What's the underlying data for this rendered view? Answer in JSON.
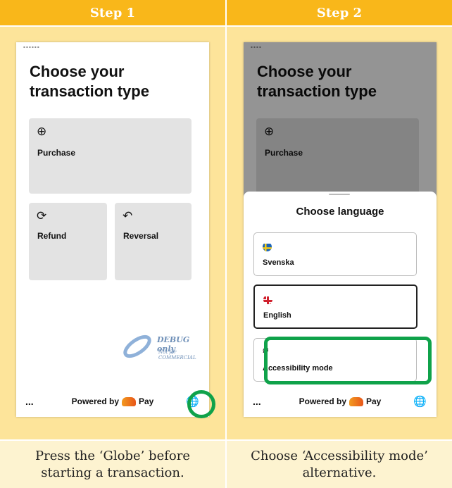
{
  "steps": [
    {
      "header": "Step 1",
      "caption_line1": "Press the ‘Globe’ before",
      "caption_line2": "starting a transaction.",
      "screen": {
        "title_line1": "Choose your",
        "title_line2": "transaction type",
        "tiles": [
          {
            "label": "Purchase",
            "icon": "plus-circle-icon"
          },
          {
            "label": "Refund",
            "icon": "refresh-icon"
          },
          {
            "label": "Reversal",
            "icon": "reverse-icon"
          }
        ],
        "footer": {
          "more": "...",
          "powered_prefix": "Powered by",
          "powered_suffix": "Pay",
          "globe_icon": "globe-icon"
        },
        "watermark": {
          "text": "DEBUG only",
          "subtext": "Not for COMMERCIAL"
        }
      }
    },
    {
      "header": "Step 2",
      "caption_line1": "Choose ‘Accessibility mode’",
      "caption_line2": "alternative.",
      "screen": {
        "title_line1": "Choose your",
        "title_line2": "transaction type",
        "background_tile": "Purchase",
        "sheet_title": "Choose language",
        "options": [
          {
            "label": "Svenska",
            "icon": "sweden-flag-icon"
          },
          {
            "label": "English",
            "icon": "uk-flag-icon",
            "selected": true
          },
          {
            "label": "Accessibility mode",
            "icon": "eye-off-icon"
          }
        ],
        "footer": {
          "more": "...",
          "powered_prefix": "Powered by",
          "powered_suffix": "Pay",
          "globe_icon": "globe-icon"
        }
      }
    }
  ],
  "colors": {
    "header": "#f9b71a",
    "panel": "#fde49a",
    "caption_bg": "#fdf3d0",
    "highlight": "#0fa24a"
  }
}
